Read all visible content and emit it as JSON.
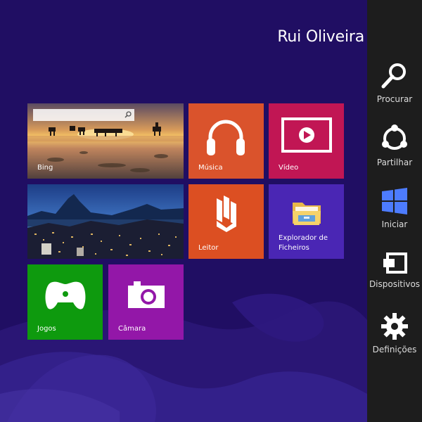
{
  "user": {
    "name": "Rui Oliveira"
  },
  "tiles": {
    "bing": "Bing",
    "musica": "Música",
    "video": "Vídeo",
    "leitor": "Leitor",
    "explorer": "Explorador de Ficheiros",
    "jogos": "Jogos",
    "camara": "Câmara"
  },
  "charms": {
    "procurar": "Procurar",
    "partilhar": "Partilhar",
    "iniciar": "Iniciar",
    "dispositivos": "Dispositivos",
    "definicoes": "Definições"
  },
  "colors": {
    "background": "#200e63",
    "charms_bar": "#1d1d1d",
    "musica": "#da532c",
    "video": "#c11654",
    "leitor": "#dc4f22",
    "explorer": "#4a26b4",
    "jogos": "#0e9a0e",
    "camara": "#9317a8",
    "iniciar_icon": "#4d7cff"
  },
  "icons": {
    "procurar": "magnifier-icon",
    "partilhar": "share-icon",
    "iniciar": "windows-logo-icon",
    "dispositivos": "devices-icon",
    "definicoes": "gear-icon"
  }
}
